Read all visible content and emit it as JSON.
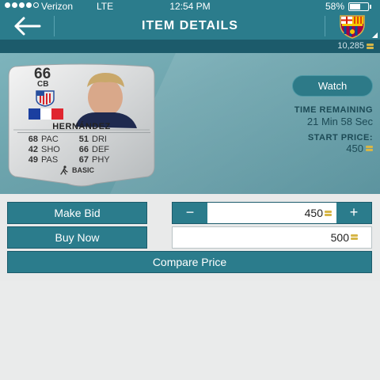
{
  "status_bar": {
    "carrier": "Verizon",
    "network": "LTE",
    "time": "12:54 PM",
    "battery_pct": "58%",
    "battery_level": 0.58,
    "signal_bars_filled": 4,
    "signal_bars_total": 5
  },
  "nav": {
    "title": "ITEM DETAILS",
    "back_icon": "back-arrow-icon",
    "club_badge": "fc-barcelona-crest"
  },
  "coins": {
    "balance": "10,285",
    "icon": "coin-icon"
  },
  "card": {
    "rating": "66",
    "position": "CB",
    "name": "HERNÁNDEZ",
    "quality": "BASIC",
    "club": "atletico-madrid-crest",
    "nation": "france-flag",
    "stats": [
      {
        "value": "68",
        "label": "PAC",
        "value2": "51",
        "label2": "DRI"
      },
      {
        "value": "42",
        "label": "SHO",
        "value2": "66",
        "label2": "DEF"
      },
      {
        "value": "49",
        "label": "PAS",
        "value2": "67",
        "label2": "PHY"
      }
    ]
  },
  "info": {
    "watch_label": "Watch",
    "time_remaining_label": "TIME REMAINING",
    "time_remaining_value": "21 Min 58 Sec",
    "start_price_label": "START PRICE:",
    "start_price_value": "450"
  },
  "actions": {
    "make_bid_label": "Make Bid",
    "bid_value": "450",
    "minus": "−",
    "plus": "+",
    "buy_now_label": "Buy Now",
    "buy_now_value": "500",
    "compare_label": "Compare Price"
  },
  "colors": {
    "primary": "#2b7c8c",
    "primary_dark": "#1c5b6b",
    "hero": "#6da4ad",
    "coin_gold": "#d6b647",
    "background": "#e9eaea"
  }
}
